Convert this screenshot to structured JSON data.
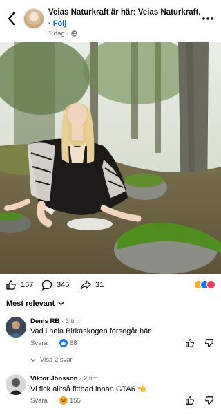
{
  "post": {
    "title": "Veias Naturkraft är här: Veias Naturkraft.",
    "follow_label": "· Följ",
    "time": "1 dag ·",
    "privacy_icon": "globe-icon"
  },
  "reactions": {
    "like_count": "157",
    "comment_count": "345",
    "share_count": "31",
    "icons": [
      "haha-emoji",
      "like-blue",
      "love-red"
    ]
  },
  "sort": {
    "label": "Mest relevant"
  },
  "comments": [
    {
      "author": "Denis RB",
      "time": "· 3 tim",
      "text": "Vad i hela Birkaskogen försegår här",
      "reply_label": "Svara",
      "reaction_count": "88",
      "view_replies": "Visa 2 svar"
    },
    {
      "author": "Viktor Jönsson",
      "time": "· 2 tim",
      "text": "Vi fick alltså fittbad innan GTA6 👈",
      "reply_label": "Svara",
      "reaction_count": "155"
    }
  ],
  "colors": {
    "link_blue": "#0866ff",
    "secondary_text": "#65676b",
    "like_blue": "#1877f2",
    "love_red": "#f33e58",
    "haha_yellow": "#f7b125"
  }
}
